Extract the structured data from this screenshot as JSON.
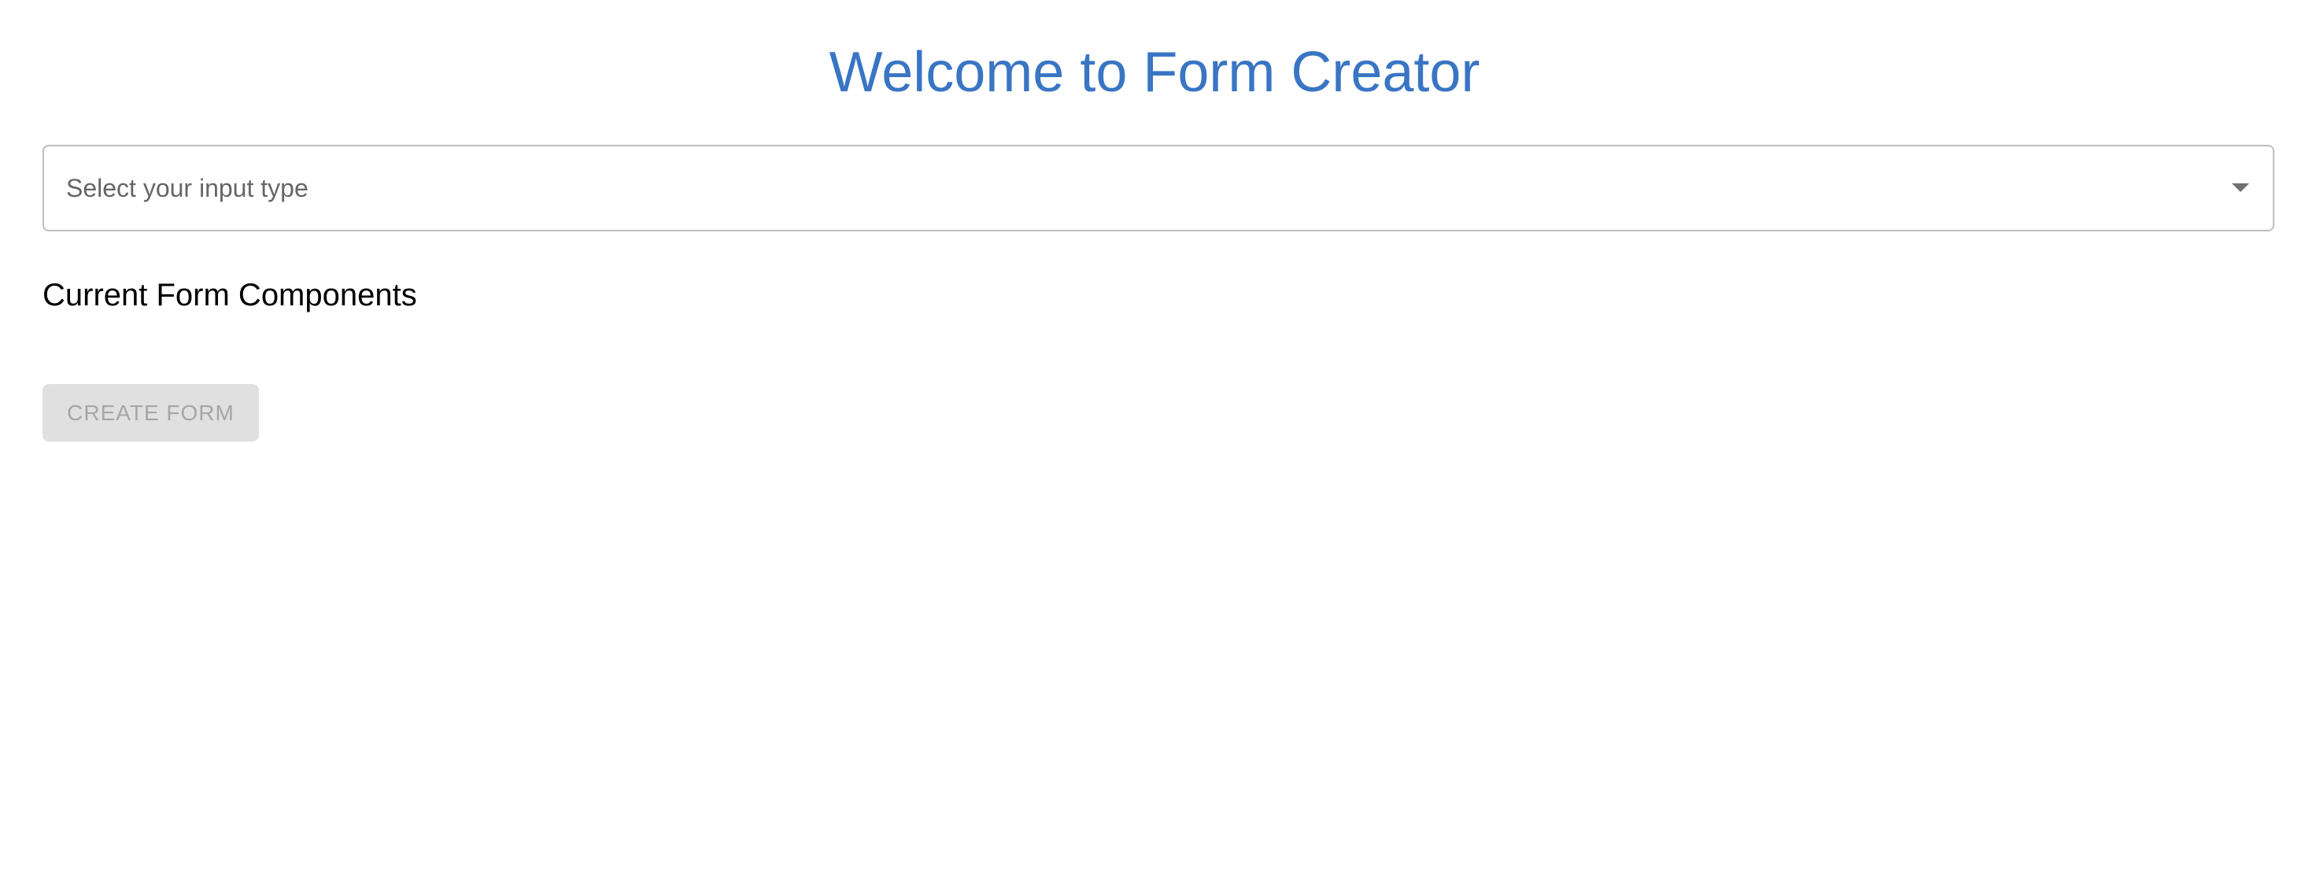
{
  "header": {
    "title": "Welcome to Form Creator"
  },
  "input_type_select": {
    "placeholder": "Select your input type",
    "icon": "chevron-down-icon"
  },
  "components_section": {
    "title": "Current Form Components",
    "items": []
  },
  "actions": {
    "create_form_label": "CREATE FORM",
    "create_form_disabled": true
  },
  "colors": {
    "title": "#3a75c4",
    "disabled_button_bg": "#e0e0e0",
    "disabled_button_text": "#a6a6a6"
  }
}
